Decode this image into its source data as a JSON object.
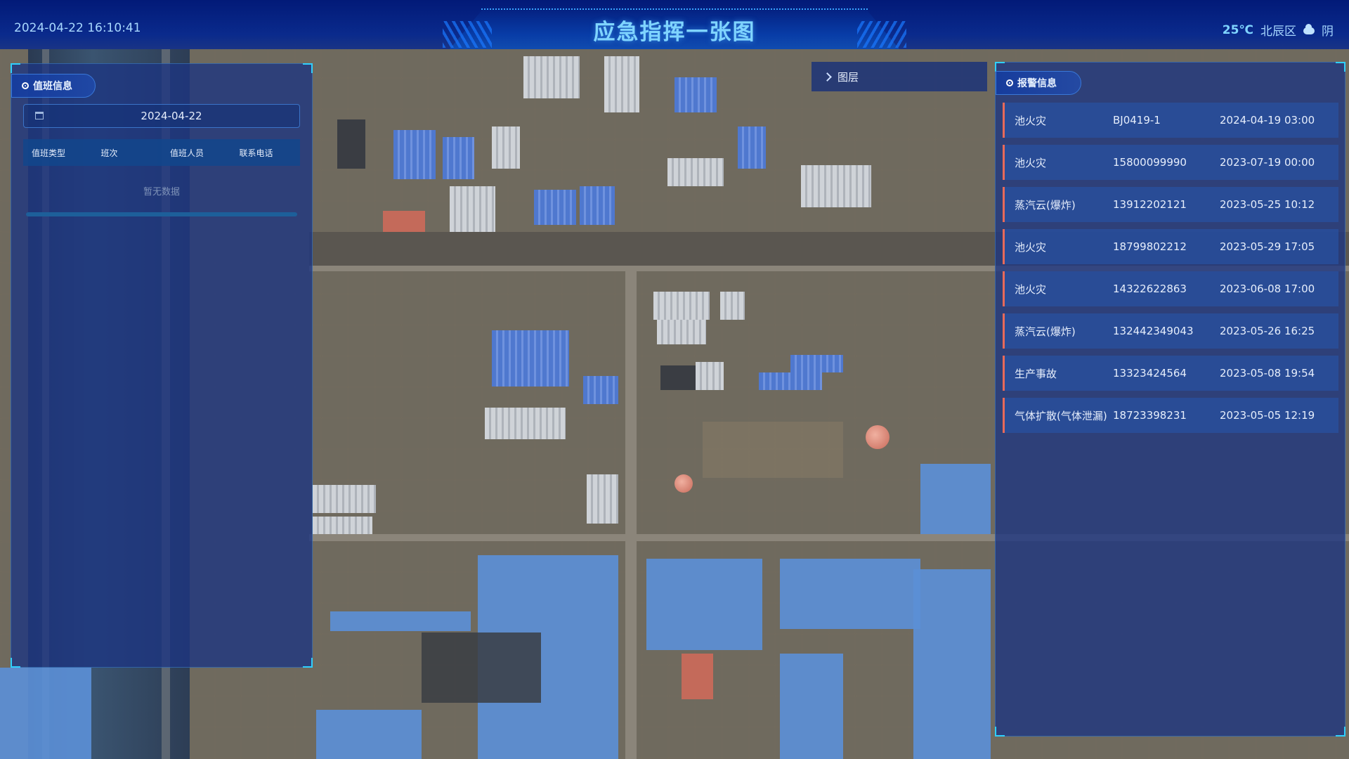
{
  "header": {
    "title": "应急指挥一张图",
    "datetime": "2024-04-22 16:10:41",
    "weather": {
      "temperature": "25℃",
      "district": "北辰区",
      "condition": "阴",
      "icon": "cloud-icon"
    }
  },
  "duty_panel": {
    "title": "值班信息",
    "date": "2024-04-22",
    "columns": [
      "值班类型",
      "班次",
      "值班人员",
      "联系电话"
    ],
    "empty_text": "暂无数据"
  },
  "layer_panel": {
    "label": "图层"
  },
  "alarm_panel": {
    "title": "报警信息",
    "items": [
      {
        "type": "池火灾",
        "id": "BJ0419-1",
        "time": "2024-04-19 03:00"
      },
      {
        "type": "池火灾",
        "id": "15800099990",
        "time": "2023-07-19 00:00"
      },
      {
        "type": "蒸汽云(爆炸)",
        "id": "13912202121",
        "time": "2023-05-25 10:12"
      },
      {
        "type": "池火灾",
        "id": "18799802212",
        "time": "2023-05-29 17:05"
      },
      {
        "type": "池火灾",
        "id": "14322622863",
        "time": "2023-06-08 17:00"
      },
      {
        "type": "蒸汽云(爆炸)",
        "id": "132442349043",
        "time": "2023-05-26 16:25"
      },
      {
        "type": "生产事故",
        "id": "13323424564",
        "time": "2023-05-08 19:54"
      },
      {
        "type": "气体扩散(气体泄漏)",
        "id": "18723398231",
        "time": "2023-05-05 12:19"
      }
    ]
  },
  "colors": {
    "header_bg": "#0a2a8c",
    "title": "#7fd4ff",
    "panel_bg": "#1c3482",
    "alarm_accent": "#e86a5a"
  }
}
